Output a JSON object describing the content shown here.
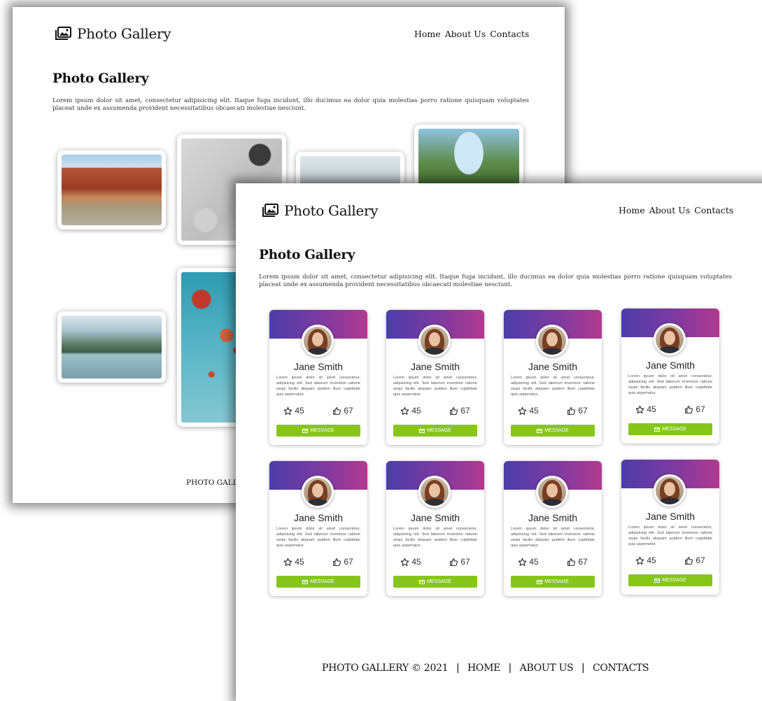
{
  "brand": {
    "name": "Photo Gallery",
    "icon": "image-gallery-icon"
  },
  "nav": {
    "home": "Home",
    "about": "About Us",
    "contacts": "Contacts"
  },
  "page": {
    "title": "Photo Gallery",
    "description": "Lorem ipsum dolor sit amet, consectetur adipisicing elit. Itaque fuga incidunt, illo ducimus ea dolor quia molestias porro ratione quisquam voluptates placeat unde ex assumenda provident necessitatibus obcaecati molestiae nesciunt."
  },
  "back_footer": {
    "text": "PHOTO GALLE"
  },
  "card": {
    "name": "Jane Smith",
    "text": "Lorem ipsum dolor sit amet consectetur, adipisicing elit. Sed laborum inventore ratione sequi facilis aliquam quidem illum cupiditate quis aspernatur.",
    "stars": "45",
    "likes": "67",
    "button": "MESSAGE",
    "colors": {
      "banner_start": "#4b3ea9",
      "banner_end": "#b03a8e",
      "button": "#86c61b"
    }
  },
  "footer": {
    "copyright": "PHOTO GALLERY © 2021",
    "home": "HOME",
    "about": "ABOUT US",
    "contacts": "CONTACTS",
    "separator": "|"
  }
}
